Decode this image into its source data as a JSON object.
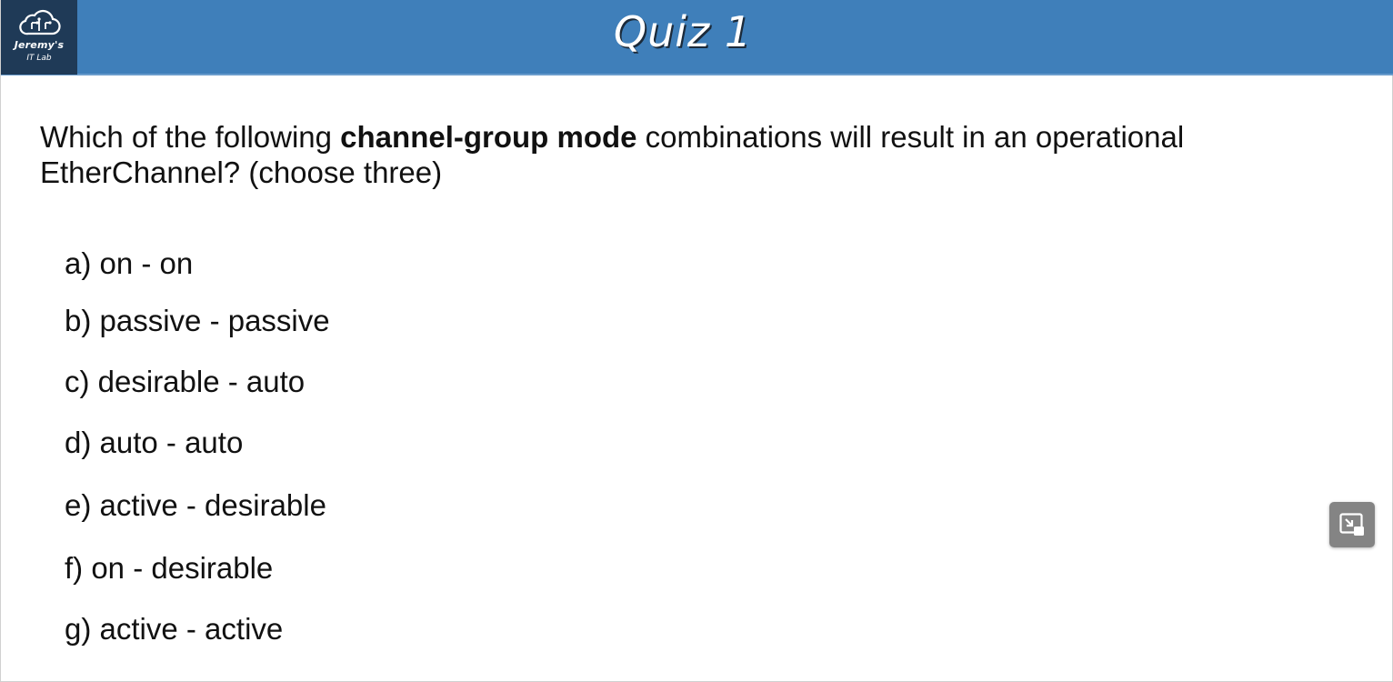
{
  "header": {
    "title": "Quiz 1",
    "logo": {
      "line1": "Jeremy's",
      "line2": "IT Lab",
      "icon": "cloud-circuit-icon"
    }
  },
  "question": {
    "text_before": "Which of the following ",
    "text_bold": "channel-group mode",
    "text_after": " combinations will result in an operational EtherChannel? (choose three)"
  },
  "options": [
    "a) on - on",
    "b) passive - passive",
    "c) desirable - auto",
    "d) auto - auto",
    "e) active - desirable",
    "f) on - desirable",
    "g) active - active"
  ],
  "controls": {
    "pip_icon": "picture-in-picture-exit-icon"
  },
  "colors": {
    "header_bg": "#3f7fba",
    "logo_bg": "#1f3a57"
  }
}
